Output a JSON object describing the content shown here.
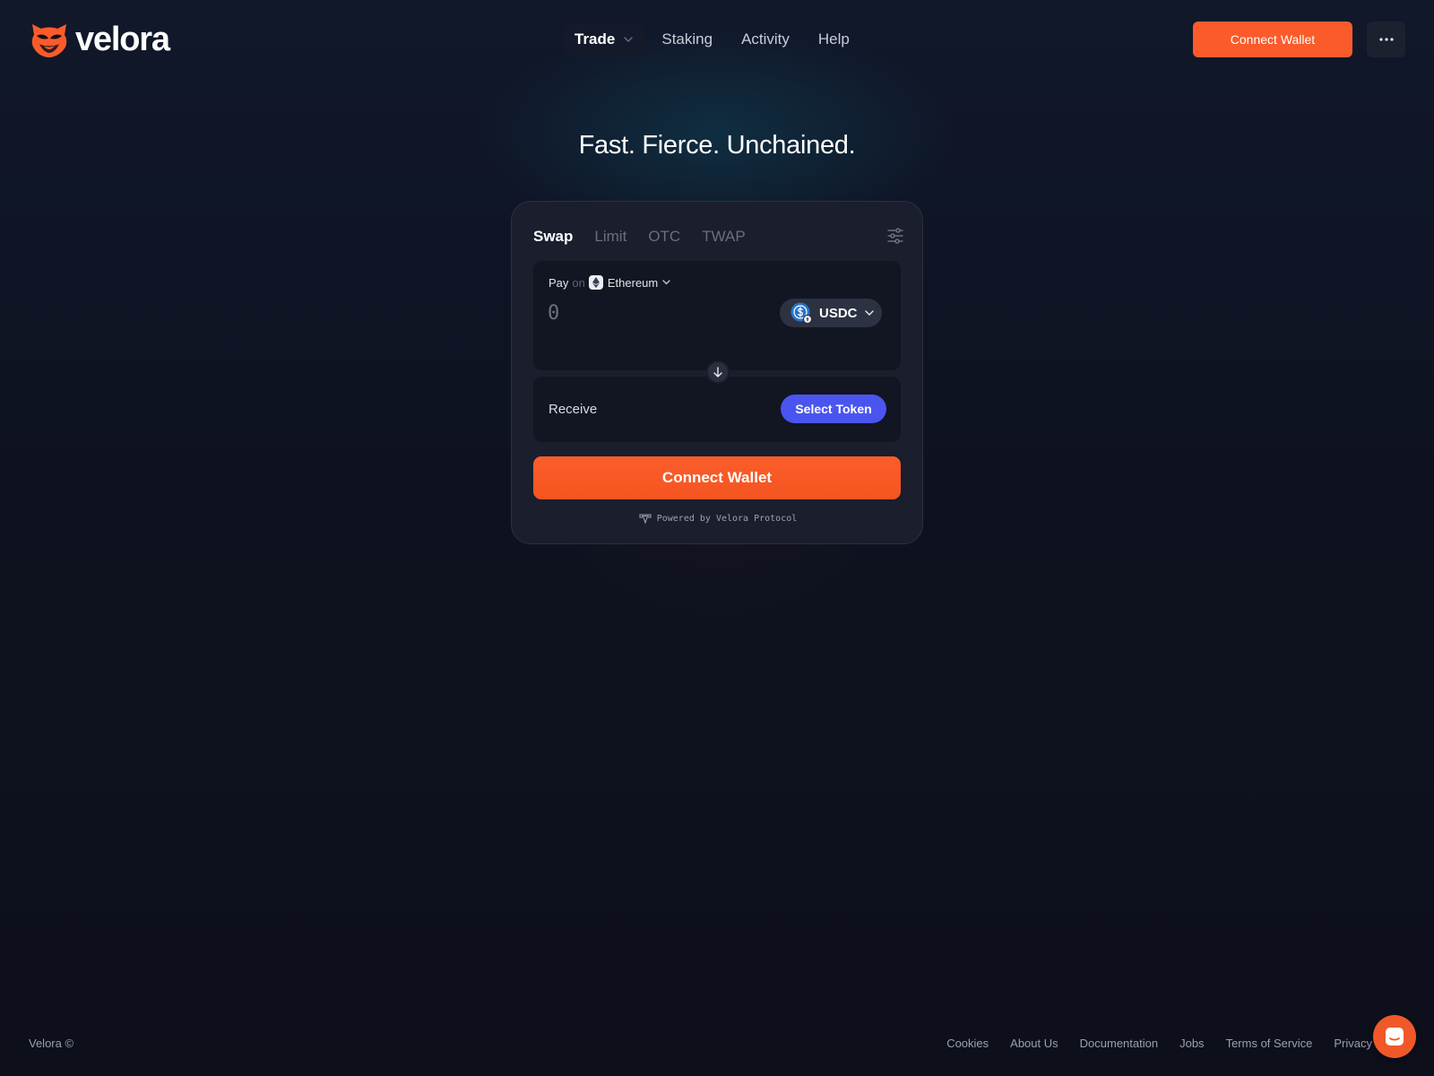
{
  "brand": {
    "name": "velora",
    "logo_icon": "fox-head-icon"
  },
  "nav": {
    "items": [
      {
        "label": "Trade",
        "has_dropdown": true,
        "active": true
      },
      {
        "label": "Staking"
      },
      {
        "label": "Activity"
      },
      {
        "label": "Help"
      }
    ]
  },
  "header": {
    "connect_label": "Connect Wallet",
    "more_icon": "ellipsis-icon"
  },
  "hero": {
    "tagline": "Fast. Fierce. Unchained."
  },
  "swap": {
    "tabs": [
      {
        "label": "Swap",
        "active": true
      },
      {
        "label": "Limit"
      },
      {
        "label": "OTC"
      },
      {
        "label": "TWAP"
      }
    ],
    "settings_icon": "sliders-icon",
    "pay": {
      "label": "Pay",
      "on_label": "on",
      "chain": "Ethereum",
      "amount_placeholder": "0",
      "token": "USDC"
    },
    "receive": {
      "label": "Receive",
      "select_label": "Select Token"
    },
    "connect_label": "Connect Wallet",
    "powered_by": "Powered by Velora Protocol"
  },
  "footer": {
    "copyright": "Velora ©",
    "links": [
      "Cookies",
      "About Us",
      "Documentation",
      "Jobs",
      "Terms of Service",
      "Privacy"
    ]
  },
  "colors": {
    "accent": "#fb5b2a",
    "select_token": "#4a55f0",
    "background": "#0e111d",
    "card": "#1a1e2d"
  }
}
